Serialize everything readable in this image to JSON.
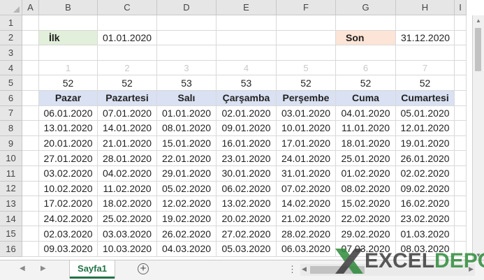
{
  "columns": [
    "A",
    "B",
    "C",
    "D",
    "E",
    "F",
    "G",
    "H",
    "I"
  ],
  "rows": [
    "1",
    "2",
    "3",
    "4",
    "5",
    "6",
    "7",
    "8",
    "9",
    "10",
    "11",
    "12",
    "13",
    "14",
    "15",
    "16"
  ],
  "row2": {
    "ilk_label": "İlk",
    "ilk_value": "01.01.2020",
    "son_label": "Son",
    "son_value": "31.12.2020"
  },
  "row4": [
    "1",
    "2",
    "3",
    "4",
    "5",
    "6",
    "7"
  ],
  "row5": [
    "52",
    "52",
    "53",
    "53",
    "52",
    "52",
    "52"
  ],
  "headers": [
    "Pazar",
    "Pazartesi",
    "Salı",
    "Çarşamba",
    "Perşembe",
    "Cuma",
    "Cumartesi"
  ],
  "data": [
    [
      "06.01.2020",
      "07.01.2020",
      "01.01.2020",
      "02.01.2020",
      "03.01.2020",
      "04.01.2020",
      "05.01.2020"
    ],
    [
      "13.01.2020",
      "14.01.2020",
      "08.01.2020",
      "09.01.2020",
      "10.01.2020",
      "11.01.2020",
      "12.01.2020"
    ],
    [
      "20.01.2020",
      "21.01.2020",
      "15.01.2020",
      "16.01.2020",
      "17.01.2020",
      "18.01.2020",
      "19.01.2020"
    ],
    [
      "27.01.2020",
      "28.01.2020",
      "22.01.2020",
      "23.01.2020",
      "24.01.2020",
      "25.01.2020",
      "26.01.2020"
    ],
    [
      "03.02.2020",
      "04.02.2020",
      "29.01.2020",
      "30.01.2020",
      "31.01.2020",
      "01.02.2020",
      "02.02.2020"
    ],
    [
      "10.02.2020",
      "11.02.2020",
      "05.02.2020",
      "06.02.2020",
      "07.02.2020",
      "08.02.2020",
      "09.02.2020"
    ],
    [
      "17.02.2020",
      "18.02.2020",
      "12.02.2020",
      "13.02.2020",
      "14.02.2020",
      "15.02.2020",
      "16.02.2020"
    ],
    [
      "24.02.2020",
      "25.02.2020",
      "19.02.2020",
      "20.02.2020",
      "21.02.2020",
      "22.02.2020",
      "23.02.2020"
    ],
    [
      "02.03.2020",
      "03.03.2020",
      "26.02.2020",
      "27.02.2020",
      "28.02.2020",
      "29.02.2020",
      "01.03.2020"
    ],
    [
      "09.03.2020",
      "10.03.2020",
      "04.03.2020",
      "05.03.2020",
      "06.03.2020",
      "07.03.2020",
      "08.03.2020"
    ]
  ],
  "sheet_tab": "Sayfa1",
  "add_sheet": "+",
  "dots": "⋮",
  "watermark": {
    "excel": "EXCEL",
    "depo": "DEPO"
  },
  "colors": {
    "header_fill": "#d9e1f2",
    "ilk_fill": "#e2efda",
    "son_fill": "#fce4d6",
    "accent": "#217346"
  }
}
